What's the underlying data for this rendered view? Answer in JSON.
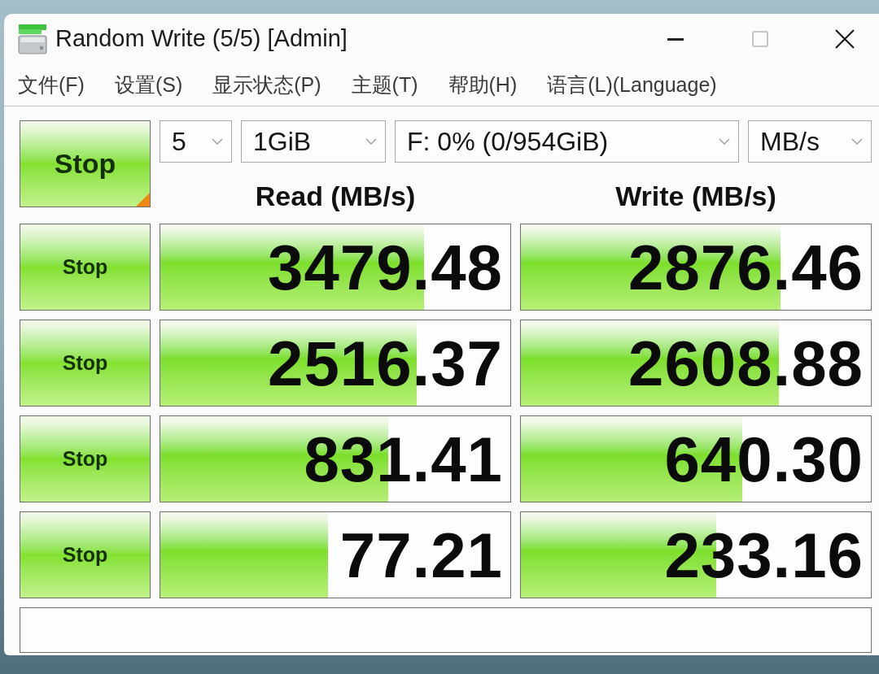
{
  "window": {
    "title": "Random Write (5/5) [Admin]"
  },
  "menu": [
    "文件(F)",
    "设置(S)",
    "显示状态(P)",
    "主题(T)",
    "帮助(H)",
    "语言(L)(Language)"
  ],
  "toolbar": {
    "start_button": "Stop",
    "dropdowns": [
      {
        "value": "5"
      },
      {
        "value": "1GiB"
      },
      {
        "value": "F: 0% (0/954GiB)"
      },
      {
        "value": "MB/s"
      }
    ]
  },
  "headers": [
    "Read (MB/s)",
    "Write (MB/s)"
  ],
  "results": [
    {
      "button": "Stop",
      "read": {
        "value": "3479.48",
        "level": 0.754
      },
      "write": {
        "value": "2876.46",
        "level": 0.742
      }
    },
    {
      "button": "Stop",
      "read": {
        "value": "2516.37",
        "level": 0.733
      },
      "write": {
        "value": "2608.88",
        "level": 0.738
      }
    },
    {
      "button": "Stop",
      "read": {
        "value": "831.41",
        "level": 0.65
      },
      "write": {
        "value": "640.30",
        "level": 0.633
      }
    },
    {
      "button": "Stop",
      "read": {
        "value": "77.21",
        "level": 0.478
      },
      "write": {
        "value": "233.16",
        "level": 0.557
      }
    }
  ]
}
